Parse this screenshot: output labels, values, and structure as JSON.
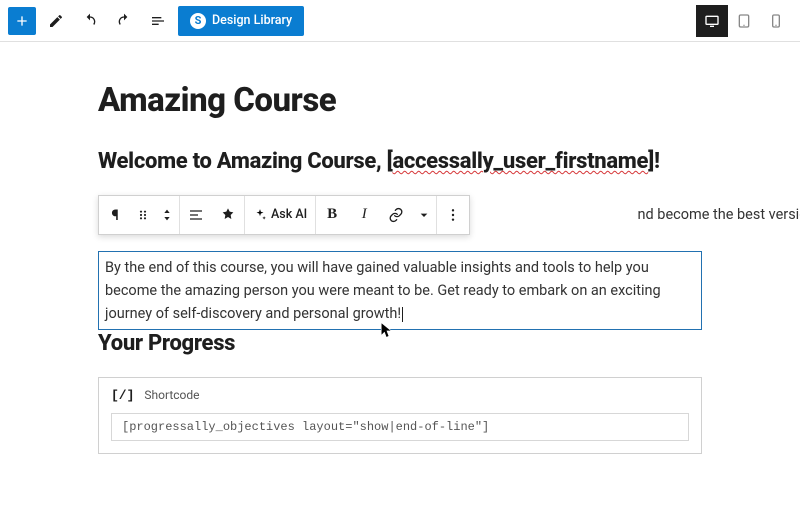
{
  "topbar": {
    "design_library_label": "Design Library",
    "design_library_glyph": "S"
  },
  "page": {
    "title": "Amazing Course",
    "welcome_prefix": "Welcome to Amazing Course, [",
    "welcome_shortcode": "accessally_user_firstname",
    "welcome_suffix": "]!",
    "hidden_line_tail": "nd become the best version of yourself.",
    "paragraph": "By the end of this course, you will have gained valuable insights and tools to help you become the amazing person you were meant to be. Get ready to embark on an exciting journey of self-discovery and personal growth!"
  },
  "block_toolbar": {
    "paragraph_glyph": "¶",
    "ask_ai_label": "Ask AI",
    "bold_glyph": "B",
    "italic_glyph": "I"
  },
  "progress": {
    "heading": "Your Progress",
    "shortcode_icon": "[/]",
    "shortcode_label": "Shortcode",
    "shortcode_value": "[progressally_objectives layout=\"show|end-of-line\"]"
  }
}
